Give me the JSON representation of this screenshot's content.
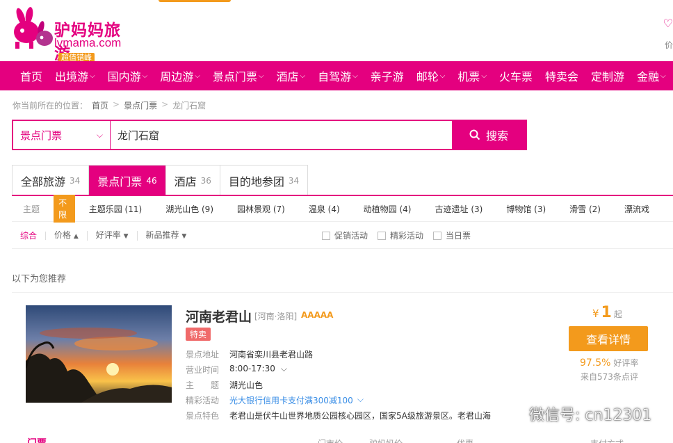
{
  "brand": {
    "name": "驴妈妈旅游",
    "url": "lvmama.com",
    "badge": "超值错峰",
    "color": "#e4007f"
  },
  "header_right": {
    "text": "价"
  },
  "nav": {
    "items": [
      {
        "label": "首页",
        "caret": false
      },
      {
        "label": "出境游",
        "caret": true
      },
      {
        "label": "国内游",
        "caret": true
      },
      {
        "label": "周边游",
        "caret": true
      },
      {
        "label": "景点门票",
        "caret": true
      },
      {
        "label": "酒店",
        "caret": true
      },
      {
        "label": "自驾游",
        "caret": true
      },
      {
        "label": "亲子游",
        "caret": false
      },
      {
        "label": "邮轮",
        "caret": true
      },
      {
        "label": "机票",
        "caret": true
      },
      {
        "label": "火车票",
        "caret": false
      },
      {
        "label": "特卖会",
        "caret": false
      },
      {
        "label": "定制游",
        "caret": false
      },
      {
        "label": "金融",
        "caret": true
      }
    ]
  },
  "breadcrumb": {
    "prefix": "你当前所在的位置：",
    "items": [
      "首页",
      "景点门票",
      "龙门石窟"
    ],
    "separator": ">"
  },
  "search": {
    "category": "景点门票",
    "query": "龙门石窟",
    "button": "搜索"
  },
  "tabs": [
    {
      "label": "全部旅游",
      "count": "34",
      "active": false
    },
    {
      "label": "景点门票",
      "count": "46",
      "active": true
    },
    {
      "label": "酒店",
      "count": "36",
      "active": false
    },
    {
      "label": "目的地参团",
      "count": "34",
      "active": false
    }
  ],
  "filter": {
    "label": "主题",
    "unlimited": "不限",
    "items": [
      "主题乐园 (11)",
      "湖光山色 (9)",
      "园林景观 (7)",
      "温泉 (4)",
      "动植物园 (4)",
      "古迹遗址 (3)",
      "博物馆 (3)",
      "滑雪 (2)",
      "漂流戏"
    ]
  },
  "sort": {
    "items": [
      "综合",
      "价格",
      "好评率",
      "新品推荐"
    ],
    "checks": [
      "促销活动",
      "精彩活动",
      "当日票"
    ]
  },
  "recommend_text": "以下为您推荐",
  "card": {
    "title": "河南老君山",
    "region": "[河南·洛阳]",
    "rating": "AAAAA",
    "badge": "特卖",
    "info": [
      {
        "k": "景点地址",
        "v": "河南省栾川县老君山路"
      },
      {
        "k": "营业时间",
        "v": "8:00-17:30"
      },
      {
        "k": "主　　题",
        "v": "湖光山色"
      },
      {
        "k": "精彩活动",
        "v": "光大银行信用卡支付满300减100"
      },
      {
        "k": "景点特色",
        "v": "老君山是伏牛山世界地质公园核心园区，国家5A级旅游景区。老君山海"
      }
    ],
    "price_symbol": "¥",
    "price": "1",
    "price_suffix": "起",
    "detail_button": "查看详情",
    "score": "97.5%",
    "score_label": "好评率",
    "reviews": "来自573条点评",
    "ticket_label": "门票",
    "col_heads": [
      "门市价",
      "驴妈妈价",
      "优惠",
      "支付方式"
    ]
  },
  "watermark": "微信号: cn12301"
}
